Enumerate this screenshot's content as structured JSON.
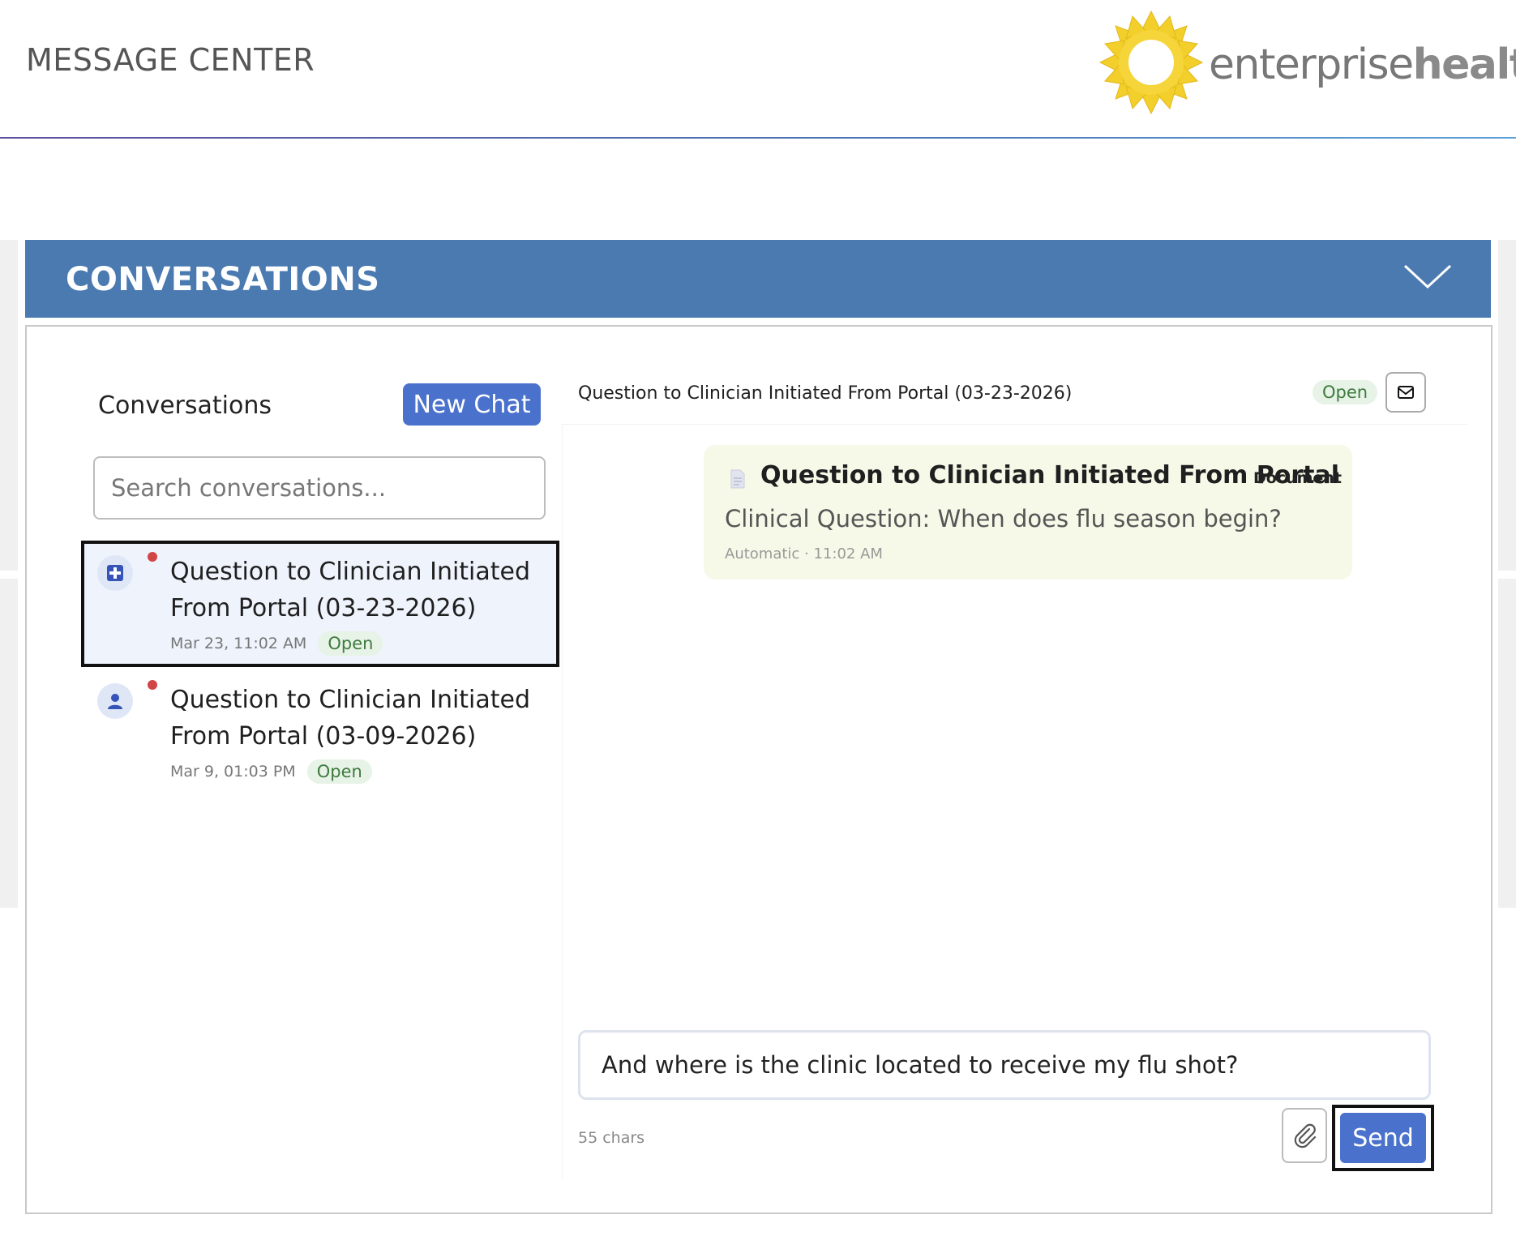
{
  "header": {
    "title": "MESSAGE CENTER",
    "logo": {
      "text_light": "enterprise",
      "text_bold": "health",
      "mark_color": "#f2cf2a"
    }
  },
  "panel": {
    "title": "CONVERSATIONS",
    "collapse_icon": "chevron-down-icon",
    "bar_color": "#4a7ab0"
  },
  "sidebar": {
    "heading": "Conversations",
    "new_chat_label": "New Chat",
    "search_placeholder": "Search conversations...",
    "conversations": [
      {
        "title": "Question to Clinician Initiated From Portal (03-23-2026)",
        "date": "Mar 23, 11:02 AM",
        "status": "Open",
        "icon": "medical-plus-icon",
        "unread": true,
        "selected": true
      },
      {
        "title": "Question to Clinician Initiated From Portal (03-09-2026)",
        "date": "Mar 9, 01:03 PM",
        "status": "Open",
        "icon": "person-icon",
        "unread": true,
        "selected": false
      }
    ]
  },
  "chat": {
    "title": "Question to Clinician Initiated From Portal (03-23-2026)",
    "status": "Open",
    "mail_icon": "envelope-icon",
    "messages": [
      {
        "icon": "document-icon",
        "title": "Question to Clinician Initiated From Portal",
        "type": "Document",
        "body": "Clinical Question: When does flu season begin?",
        "meta": "Automatic · 11:02 AM"
      }
    ],
    "compose": {
      "value": "And where is the clinic located to receive my flu shot?",
      "char_count": "55 chars",
      "attach_icon": "paperclip-icon",
      "send_label": "Send"
    }
  }
}
